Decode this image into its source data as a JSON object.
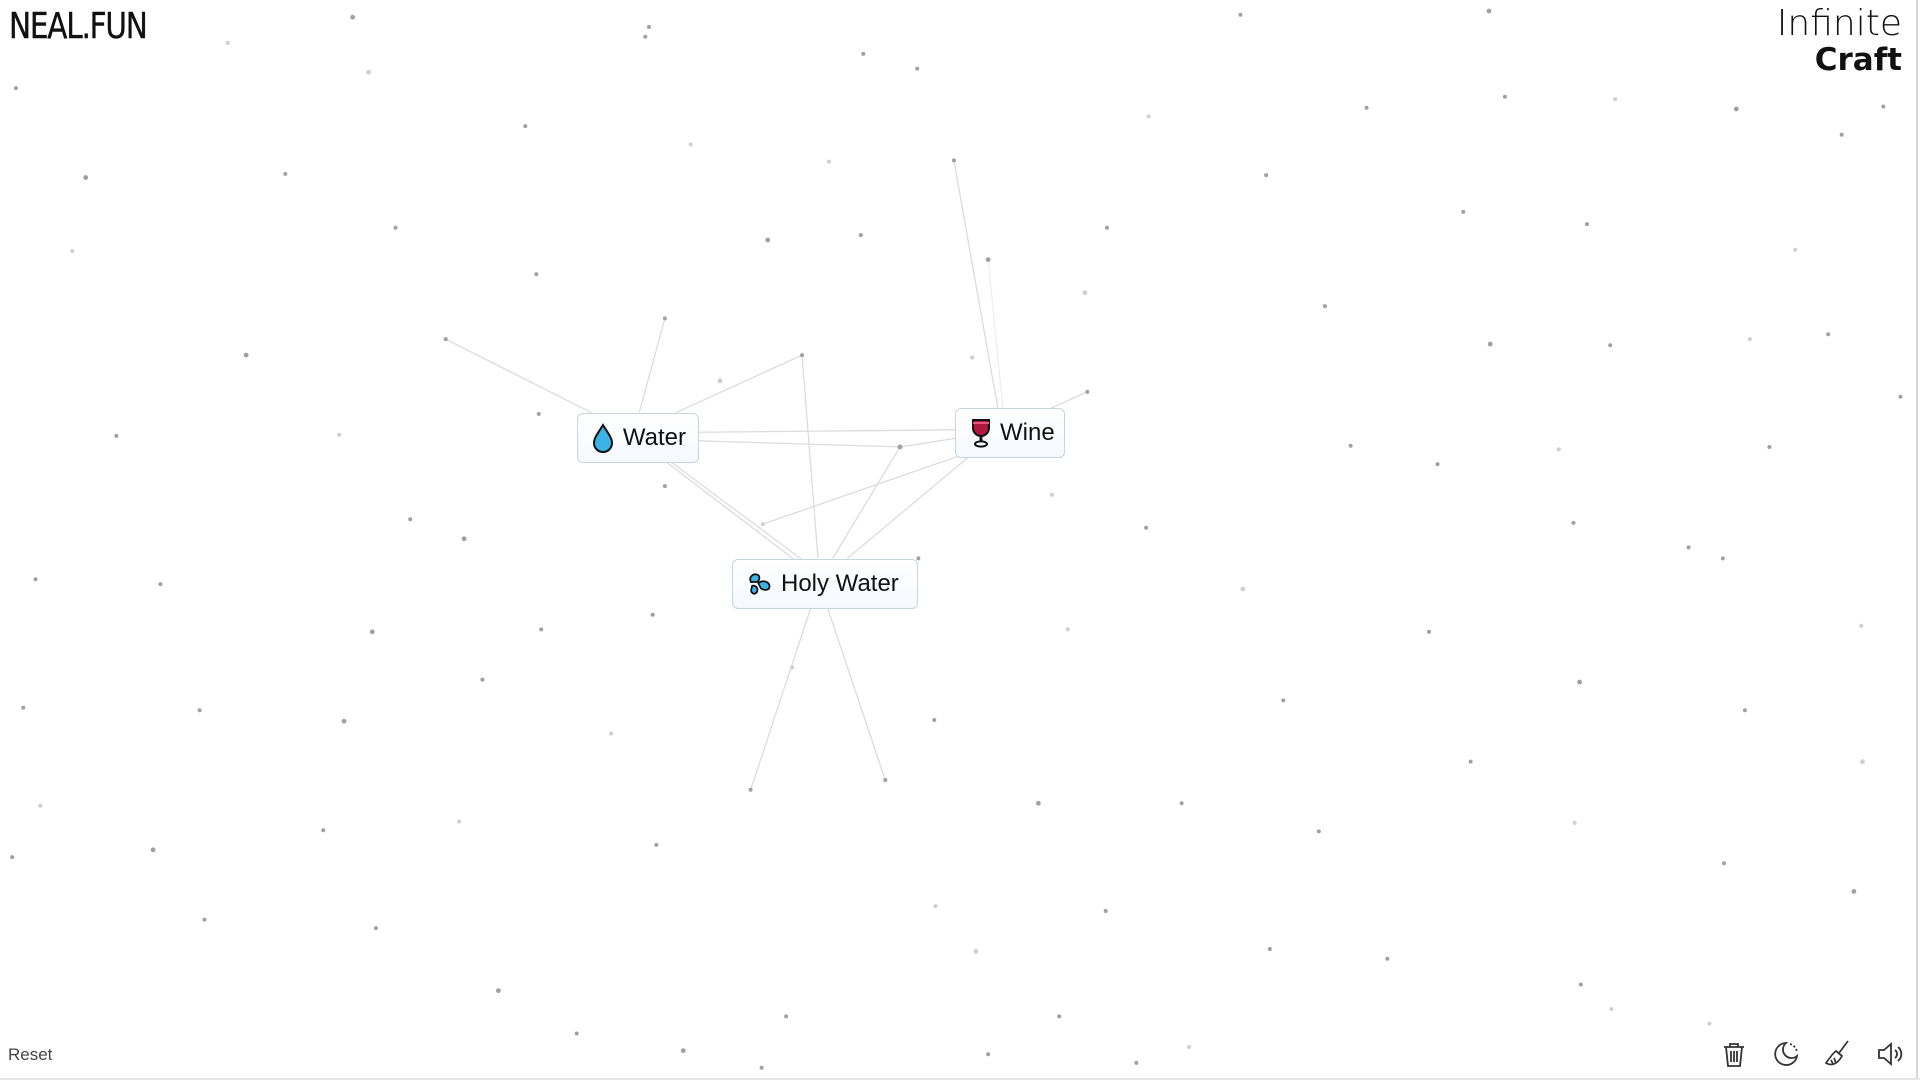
{
  "header": {
    "site_logo": "NEAL.FUN",
    "app_title_line1": "Infinite",
    "app_title_line2": "Craft"
  },
  "items": [
    {
      "name": "Water",
      "emoji_icon": "droplet-icon"
    },
    {
      "name": "Wine",
      "emoji_icon": "wine-glass-icon"
    },
    {
      "name": "Holy Water",
      "emoji_icon": "sweat-droplets-icon"
    }
  ],
  "footer": {
    "reset_label": "Reset",
    "tools": [
      {
        "name": "clear-canvas",
        "icon": "trash-icon"
      },
      {
        "name": "dark-mode",
        "icon": "moon-icon"
      },
      {
        "name": "cleanup",
        "icon": "broom-icon"
      },
      {
        "name": "sound",
        "icon": "speaker-icon"
      }
    ]
  },
  "colors": {
    "background": "#ffffff",
    "item_border": "#c8d4e0",
    "dot": "#a0a0a0",
    "line": "#dcdcdc",
    "water_blue": "#3bb4e5",
    "wine_red": "#b0173f"
  }
}
